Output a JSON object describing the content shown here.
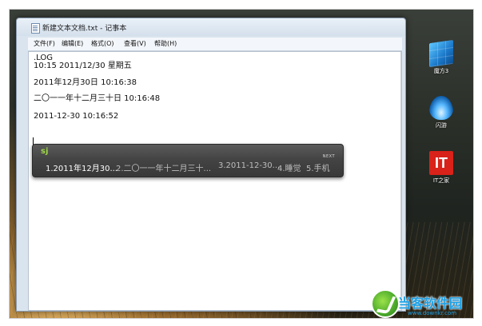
{
  "window": {
    "title": "新建文本文档.txt - 记事本"
  },
  "menubar": {
    "items": [
      "文件(F)",
      "编辑(E)",
      "格式(O)",
      "查看(V)",
      "帮助(H)"
    ]
  },
  "editor": {
    "lines": [
      ".LOG",
      "10:15 2011/12/30 星期五",
      "2011年12月30日 10:16:38",
      "二〇一一年十二月三十日 10:16:48",
      "2011-12-30 10:16:52"
    ]
  },
  "ime": {
    "input": "sj",
    "next_label": "NEXT",
    "candidates": [
      "1.2011年12月30...",
      "2.二〇一一年十二月三十...",
      "3.2011-12-30...",
      "4.睡觉",
      "5.手机"
    ],
    "selected_index": 0,
    "selected_color": "#ffffff",
    "input_color": "#9fd64a"
  },
  "desktop": {
    "icons": [
      {
        "label": "魔方3",
        "icon": "magic-cube-icon"
      },
      {
        "label": "闪游",
        "icon": "flame-icon"
      },
      {
        "label": "IT之家",
        "icon": "it-home-icon",
        "glyph_text": "IT"
      }
    ]
  },
  "watermark": {
    "brand": "当客软件园",
    "url": "www.downkr.com"
  }
}
